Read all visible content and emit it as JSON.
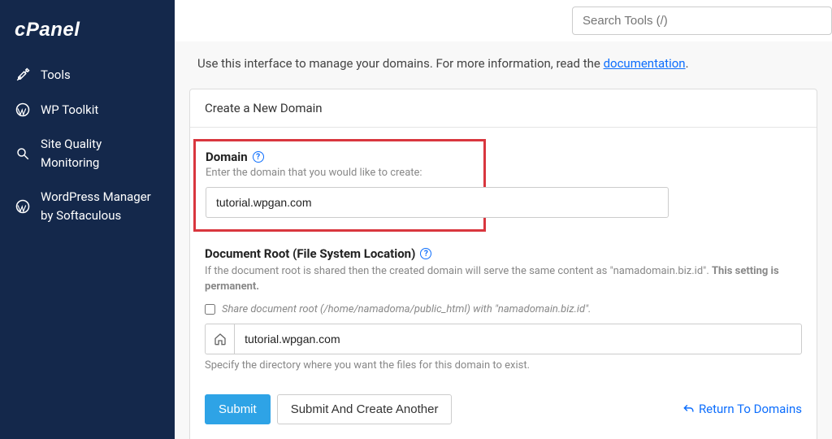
{
  "brand": "cPanel",
  "search": {
    "placeholder": "Search Tools (/)"
  },
  "sidebar": {
    "items": [
      {
        "label": "Tools"
      },
      {
        "label": "WP Toolkit"
      },
      {
        "label": "Site Quality Monitoring"
      },
      {
        "label": "WordPress Manager by Softaculous"
      }
    ]
  },
  "intro": {
    "text": "Use this interface to manage your domains. For more information, read the ",
    "link": "documentation",
    "suffix": "."
  },
  "card": {
    "title": "Create a New Domain",
    "domain": {
      "label": "Domain",
      "hint": "Enter the domain that you would like to create:",
      "value": "tutorial.wpgan.com"
    },
    "docroot": {
      "label": "Document Root (File System Location)",
      "desc1": "If the document root is shared then the created domain will serve the same content as \"namadomain.biz.id\". ",
      "desc2": "This setting is permanent.",
      "checkbox_label": "Share document root (/home/namadoma/public_html) with \"namadomain.biz.id\".",
      "value": "tutorial.wpgan.com",
      "below": "Specify the directory where you want the files for this domain to exist."
    },
    "actions": {
      "submit": "Submit",
      "submit_another": "Submit And Create Another",
      "return": "Return To Domains"
    }
  }
}
